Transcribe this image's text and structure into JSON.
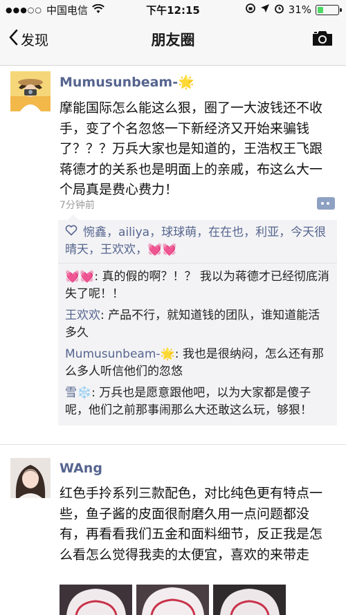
{
  "status": {
    "carrier": "中国电信",
    "time": "下午12:15",
    "battery": "31%",
    "battery_level": 0.31
  },
  "nav": {
    "back_label": "发现",
    "title": "朋友圈"
  },
  "posts": [
    {
      "name": "Mumusunbeam-🌟",
      "text": "摩能国际怎么能这么狠，圈了一大波钱还不收手，变了个名忽悠一下新经济又开始来骗钱了？？？万兵大家也是知道的，王浩权王飞跟蒋德才的关系也是明面上的亲戚，布这么大一个局真是费心费力！",
      "time": "7分钟前",
      "likes": "惋鑫，ailiya，球球萌，在在也，利亚，今天很晴天，王欢欢，💓💓",
      "comments": [
        {
          "author": "💓💓",
          "text": ": 真的假的啊？！？ 我以为蒋德才已经彻底消失了呢！！"
        },
        {
          "author": "王欢欢",
          "text": ": 产品不行，就知道钱的团队，谁知道能活多久"
        },
        {
          "author": "Mumusunbeam-🌟",
          "text": ": 我也是很纳闷，怎么还有那么多人听信他们的忽悠"
        },
        {
          "author": "雪❄️",
          "text": ": 万兵也是愿意跟他吧，以为大家都是傻子呢，他们之前那事闹那么大还敢这么玩，够狠！"
        }
      ]
    },
    {
      "name": "WAng",
      "text": "红色手拎系列三款配色，对比纯色更有特点一些，鱼子酱的皮面很耐磨久用一点问题都没有，再看看我们五金和面料细节，反正我是怎么看怎么觉得我卖的太便宜，喜欢的来带走"
    }
  ],
  "colors": {
    "name": "#56658f",
    "nav_bg": "#f7f7f7",
    "comment_bg": "#f3f3f5"
  }
}
